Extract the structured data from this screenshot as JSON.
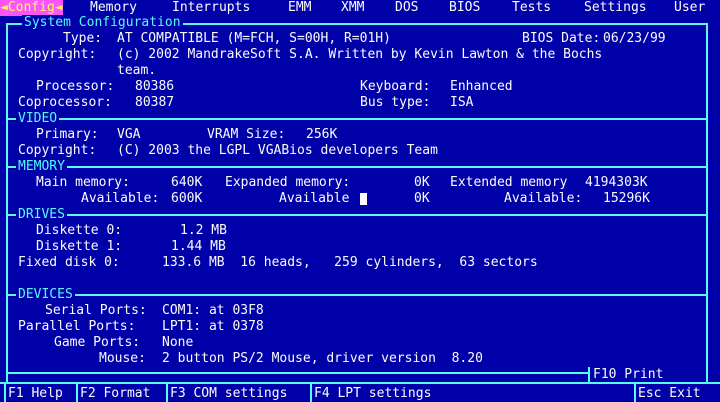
{
  "menu": {
    "items": [
      "Config",
      "Memory",
      "Interrupts",
      "EMM",
      "XMM",
      "DOS",
      "BIOS",
      "Tests",
      "Settings",
      "User"
    ]
  },
  "panel_title": "System Configuration",
  "system": {
    "type_label": "Type:",
    "type_value": "AT COMPATIBLE (M=FCH, S=00H, R=01H)",
    "bios_date_label": "BIOS Date:",
    "bios_date_value": "06/23/99",
    "copyright_label": "Copyright:",
    "copyright_line1": "(c) 2002 MandrakeSoft S.A. Written by Kevin Lawton & the Bochs",
    "copyright_line2": "team.",
    "processor_label": "Processor:",
    "processor_value": "80386",
    "keyboard_label": "Keyboard:",
    "keyboard_value": "Enhanced",
    "coprocessor_label": "Coprocessor:",
    "coprocessor_value": "80387",
    "bustype_label": "Bus type:",
    "bustype_value": "ISA"
  },
  "video": {
    "section": "VIDEO",
    "primary_label": "Primary:",
    "primary_value": "VGA",
    "vram_label": "VRAM Size:",
    "vram_value": "256K",
    "copyright_label": "Copyright:",
    "copyright_value": "(C) 2003 the LGPL VGABios developers Team"
  },
  "memory": {
    "section": "MEMORY",
    "main_label": "Main memory:",
    "main_value": "640K",
    "expanded_label": "Expanded memory:",
    "expanded_value": "0K",
    "extended_label": "Extended memory",
    "extended_value": "4194303K",
    "avail1_label": "Available:",
    "avail1_value": "600K",
    "avail2_label": "Available",
    "avail2_value": "0K",
    "avail3_label": "Available:",
    "avail3_value": "15296K"
  },
  "drives": {
    "section": "DRIVES",
    "d0_label": "Diskette 0:",
    "d0_value": "1.2 MB",
    "d1_label": "Diskette 1:",
    "d1_value": "1.44 MB",
    "fixed_label": "Fixed disk 0:",
    "fixed_value": "133.6 MB  16 heads,   259 cylinders,  63 sectors"
  },
  "devices": {
    "section": "DEVICES",
    "serial_label": "Serial Ports:",
    "serial_value": "COM1: at 03F8",
    "parallel_label": "Parallel Ports:",
    "parallel_value": "LPT1: at 0378",
    "game_label": "Game Ports:",
    "game_value": "None",
    "mouse_label": "Mouse:",
    "mouse_value": "2 button PS/2 Mouse, driver version  8.20"
  },
  "f10": "F10 Print",
  "bottom": {
    "f1": "F1 Help",
    "f2": "F2 Format",
    "f3": "F3 COM settings",
    "f4": "F4 LPT settings",
    "esc": "Esc Exit"
  },
  "colors": {
    "bg": "#0000a8",
    "cyan": "#54fcfc",
    "white": "#fcfcfc",
    "active_bg": "#fc54fc",
    "active_fg": "#fcfc54"
  }
}
